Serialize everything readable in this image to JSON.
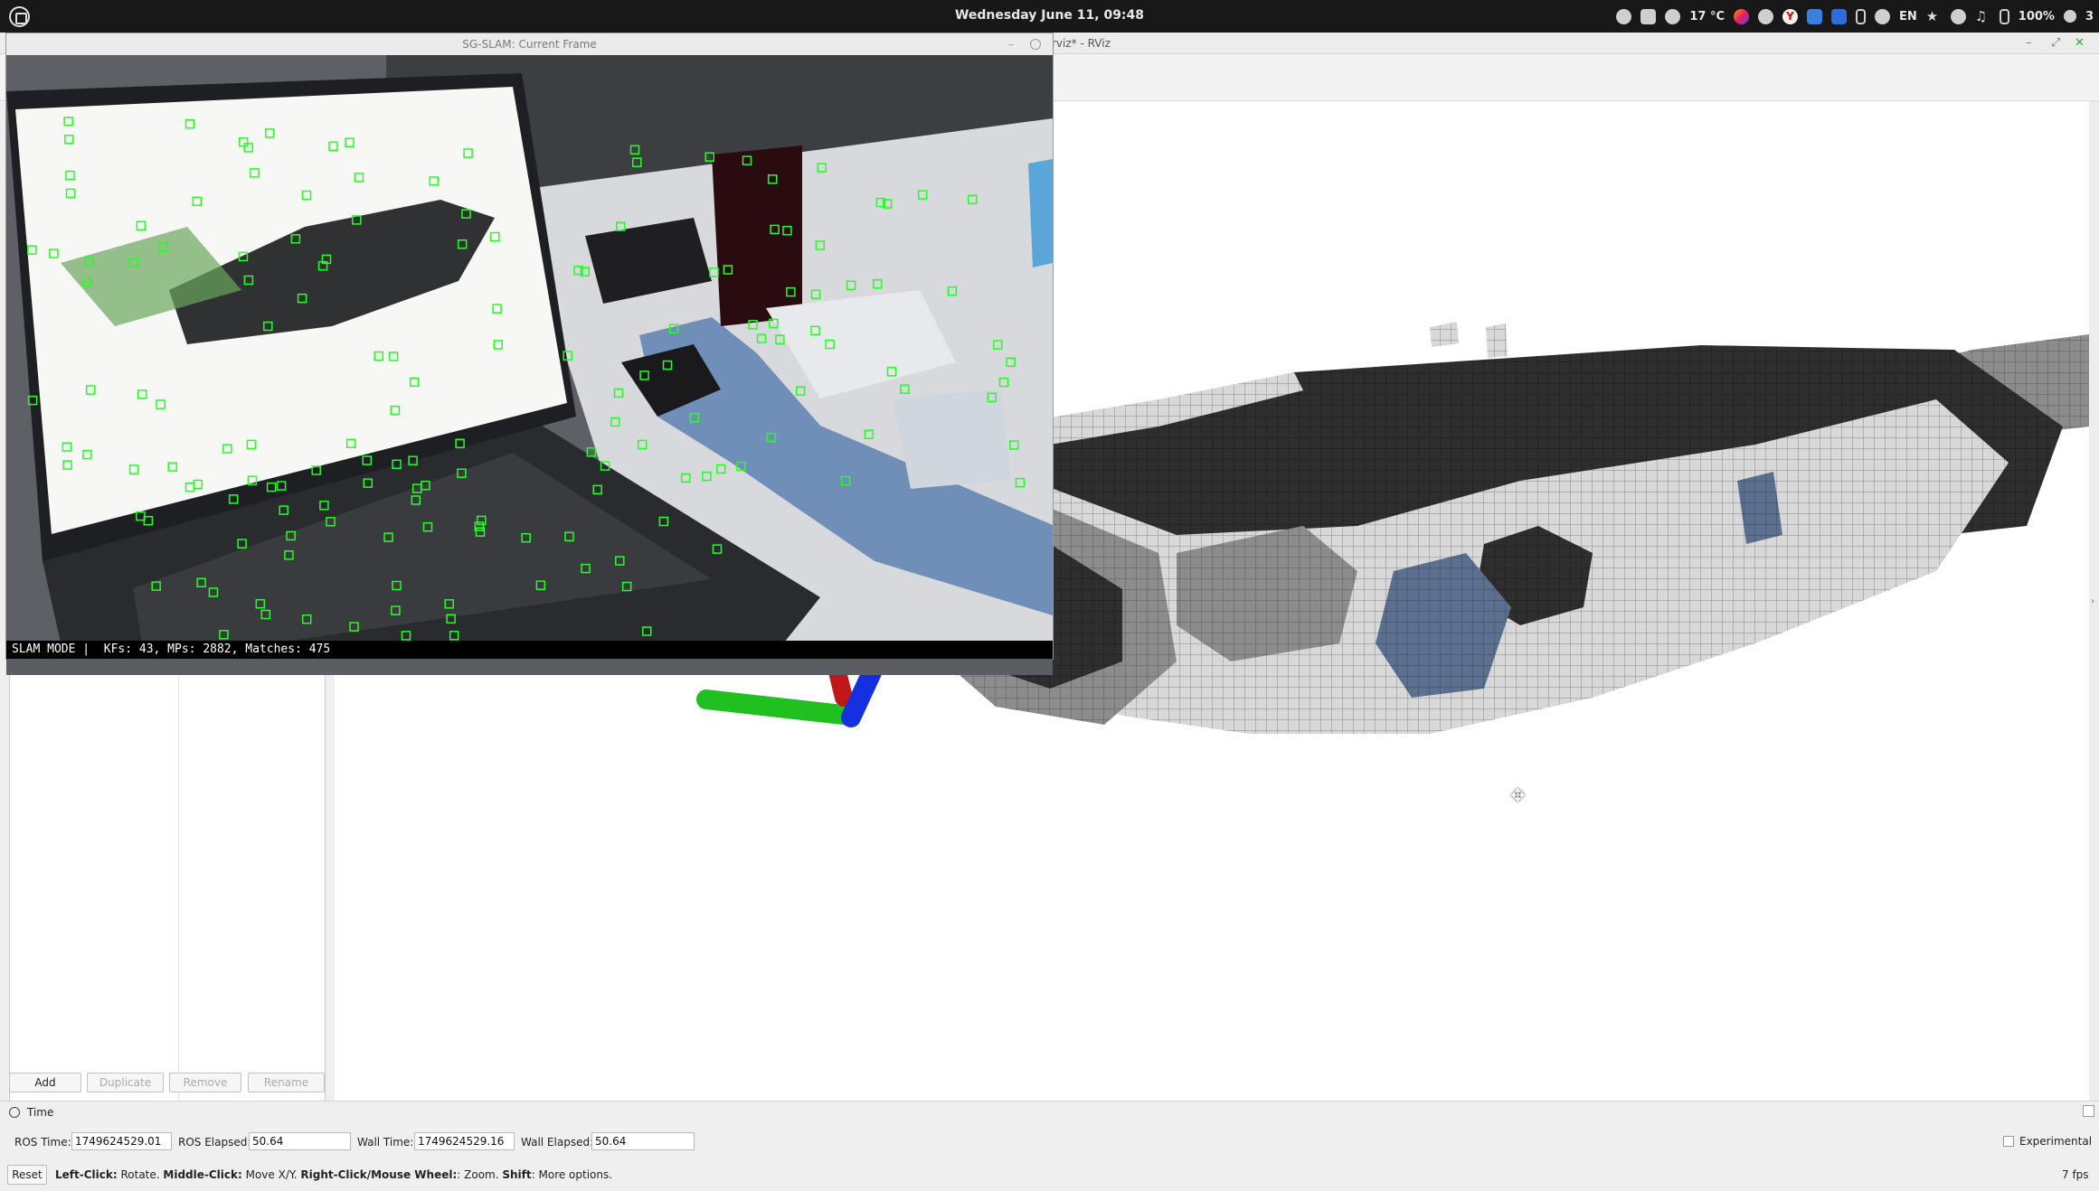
{
  "top_panel": {
    "datetime": "Wednesday June 11, 09:48",
    "temperature": "17 °C",
    "language": "EN",
    "battery": "100%",
    "notifications": "3",
    "icons": [
      "menu-logo-icon",
      "brightness-icon",
      "clipboard-icon",
      "weather-icon",
      "firefox-icon",
      "people-icon",
      "yandex-icon",
      "screenshot-icon",
      "vpn-icon",
      "bluetooth-icon",
      "cloud-icon",
      "star-icon",
      "wifi-icon",
      "music-icon",
      "battery-icon",
      "bell-icon"
    ]
  },
  "rviz_window": {
    "title": "rviz* - RViz",
    "left_panel": {
      "buttons": [
        {
          "label": "Add",
          "enabled": true
        },
        {
          "label": "Duplicate",
          "enabled": false
        },
        {
          "label": "Remove",
          "enabled": false
        },
        {
          "label": "Rename",
          "enabled": false
        }
      ]
    },
    "time_panel": {
      "header": "Time",
      "ros_time_label": "ROS Time:",
      "ros_time": "1749624529.01",
      "ros_elapsed_label": "ROS Elapsed:",
      "ros_elapsed": "50.64",
      "wall_time_label": "Wall Time:",
      "wall_time": "1749624529.16",
      "wall_elapsed_label": "Wall Elapsed:",
      "wall_elapsed": "50.64",
      "experimental_label": "Experimental",
      "experimental_checked": false
    },
    "status": {
      "reset_label": "Reset",
      "hint_parts": [
        {
          "text": "Left-Click:",
          "bold": true
        },
        {
          "text": " Rotate. ",
          "bold": false
        },
        {
          "text": "Middle-Click:",
          "bold": true
        },
        {
          "text": " Move X/Y. ",
          "bold": false
        },
        {
          "text": "Right-Click/Mouse Wheel:",
          "bold": true
        },
        {
          "text": ": Zoom. ",
          "bold": false
        },
        {
          "text": "Shift",
          "bold": true
        },
        {
          "text": ": More options.",
          "bold": false
        }
      ],
      "fps": "7 fps"
    }
  },
  "slam_window": {
    "title": "SG-SLAM: Current Frame",
    "status_line": "SLAM MODE |  KFs: 43, MPs: 2882, Matches: 475"
  },
  "colors": {
    "panel_bg": "#181818",
    "feature_point": "#22ff22",
    "axis_x": "#20c020",
    "axis_y": "#c01818",
    "axis_z": "#1530e0"
  }
}
